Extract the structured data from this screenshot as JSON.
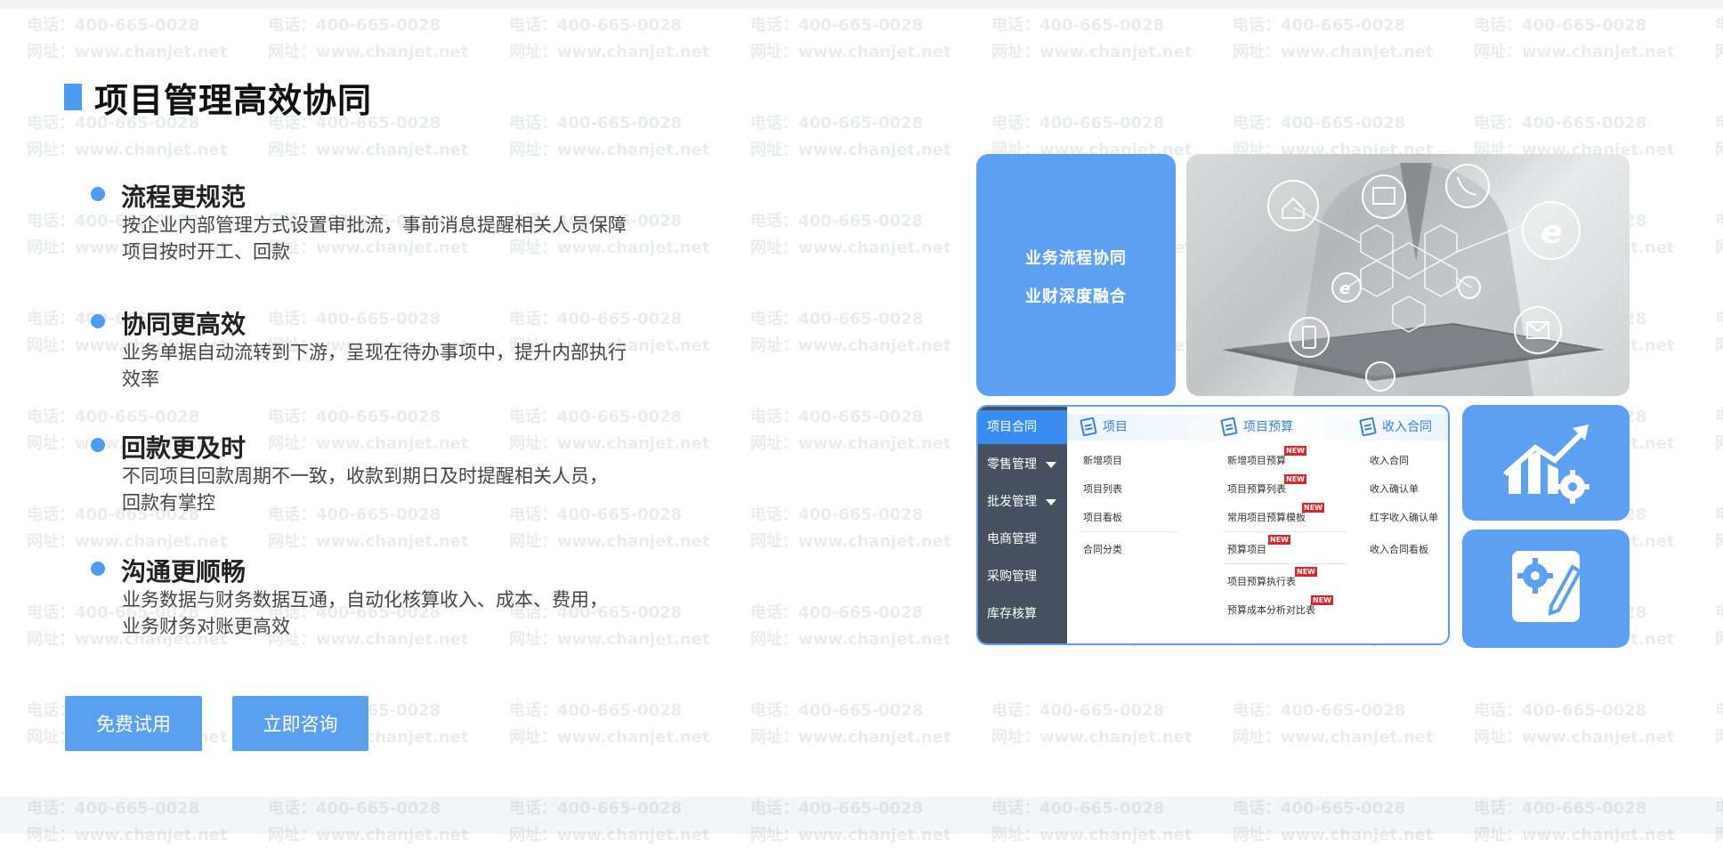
{
  "watermark": {
    "phone": "电话：400-665-0028",
    "site": "网址：www.chanjet.net"
  },
  "page": {
    "title": "项目管理高效协同"
  },
  "features": [
    {
      "title": "流程更规范",
      "desc": "按企业内部管理方式设置审批流，事前消息提醒相关人员保障项目按时开工、回款"
    },
    {
      "title": "协同更高效",
      "desc": "业务单据自动流转到下游，呈现在待办事项中，提升内部执行效率"
    },
    {
      "title": "回款更及时",
      "desc": "不同项目回款周期不一致，收款到期日及时提醒相关人员，回款有掌控"
    },
    {
      "title": "沟通更顺畅",
      "desc": "业务数据与财务数据互通，自动化核算收入、成本、费用， 业务财务对账更高效"
    }
  ],
  "buttons": {
    "trial": "免费试用",
    "consult": "立即咨询"
  },
  "visual": {
    "card_lines": [
      "业务流程协同",
      "业财深度融合"
    ],
    "menu": {
      "side": [
        {
          "label": "项目合同",
          "active": true
        },
        {
          "label": "零售管理",
          "expand": true
        },
        {
          "label": "批发管理",
          "expand": true
        },
        {
          "label": "电商管理"
        },
        {
          "label": "采购管理"
        },
        {
          "label": "库存核算"
        }
      ],
      "columns": [
        {
          "head": "项目",
          "items": [
            "新增项目",
            "项目列表",
            "项目看板",
            "合同分类"
          ]
        },
        {
          "head": "项目预算",
          "items": [
            "新增项目预算",
            "项目预算列表",
            "常用项目预算模板",
            "预算项目",
            "项目预算执行表",
            "预算成本分析对比表"
          ]
        },
        {
          "head": "收入合同",
          "items": [
            "收入合同",
            "收入确认单",
            "红字收入确认单",
            "收入合同看板"
          ]
        }
      ],
      "new_badge": "NEW"
    },
    "icons": [
      "house-icon",
      "fax-icon",
      "phone-icon",
      "ie-icon",
      "mobile-icon",
      "mail-icon",
      "chart-growth-icon",
      "settings-edit-icon"
    ]
  }
}
